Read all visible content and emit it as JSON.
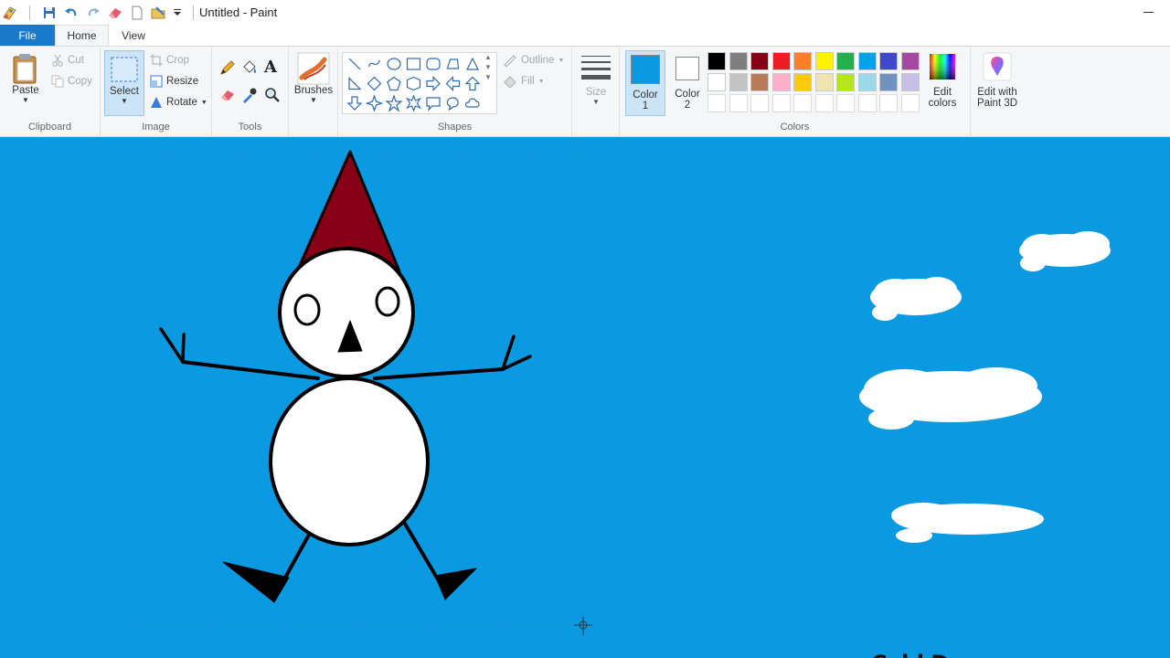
{
  "window": {
    "title": "Untitled - Paint"
  },
  "tabs": {
    "file": "File",
    "home": "Home",
    "view": "View"
  },
  "clipboard": {
    "paste": "Paste",
    "cut": "Cut",
    "copy": "Copy",
    "label": "Clipboard"
  },
  "image": {
    "select": "Select",
    "crop": "Crop",
    "resize": "Resize",
    "rotate": "Rotate",
    "label": "Image"
  },
  "tools": {
    "label": "Tools"
  },
  "brushes": {
    "label": "Brushes"
  },
  "shapes": {
    "outline": "Outline",
    "fill": "Fill",
    "label": "Shapes"
  },
  "size": {
    "label": "Size"
  },
  "colors": {
    "color1_label": "Color",
    "color1_num": "1",
    "color2_label": "Color",
    "color2_num": "2",
    "color1_value": "#0b9ae2",
    "color2_value": "#ffffff",
    "label": "Colors",
    "edit_colors_line1": "Edit",
    "edit_colors_line2": "colors",
    "paint3d_line1": "Edit with",
    "paint3d_line2": "Paint 3D",
    "palette_row1": [
      "#000000",
      "#7f7f7f",
      "#880015",
      "#ed1c24",
      "#ff7f27",
      "#fff200",
      "#22b14c",
      "#00a2e8",
      "#3f48cc",
      "#a349a4"
    ],
    "palette_row2": [
      "#ffffff",
      "#c3c3c3",
      "#b97a57",
      "#ffaec9",
      "#ffc90e",
      "#efe4b0",
      "#b5e61d",
      "#99d9ea",
      "#7092be",
      "#c8bfe7"
    ],
    "palette_row3": [
      "#ffffff",
      "#ffffff",
      "#ffffff",
      "#ffffff",
      "#ffffff",
      "#ffffff",
      "#ffffff",
      "#ffffff",
      "#ffffff",
      "#ffffff"
    ]
  },
  "canvas": {
    "background": "#0b9ae2",
    "text": "Cold Day",
    "hat_color": "#880015"
  }
}
